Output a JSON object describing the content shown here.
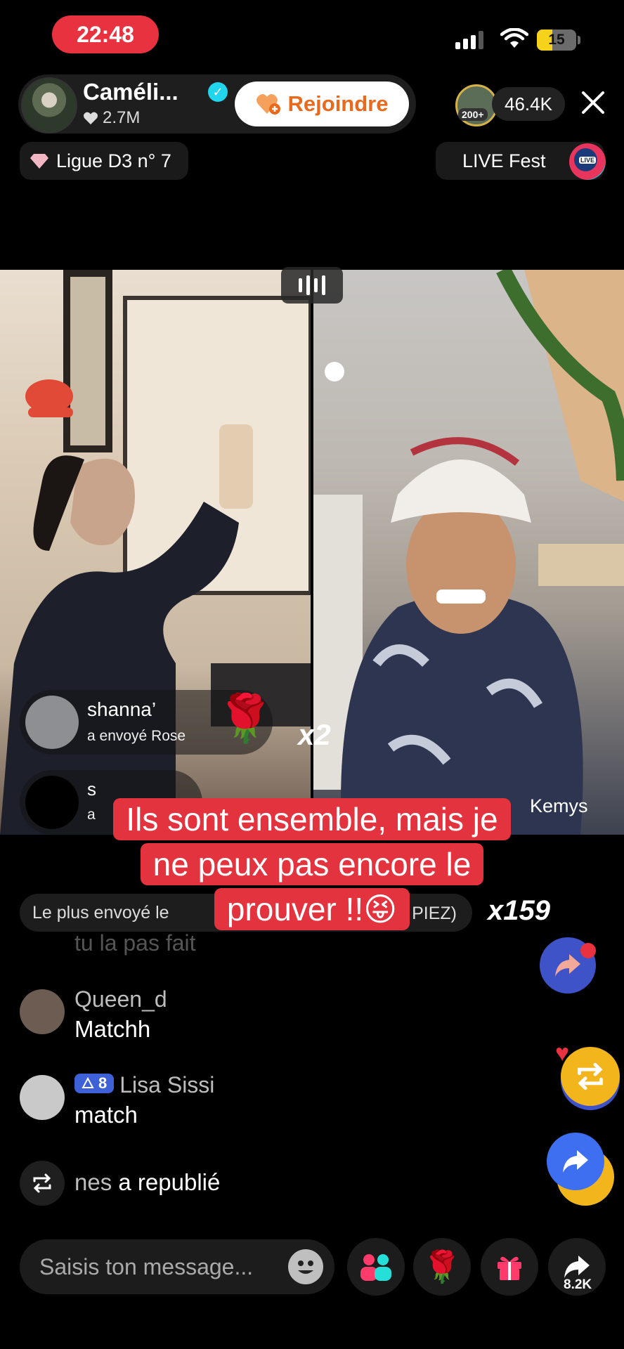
{
  "status_bar": {
    "time": "22:48",
    "battery": "15"
  },
  "host": {
    "name": "Caméli...",
    "likes": "2.7M",
    "join_label": "Rejoindre"
  },
  "viewers": {
    "badge": "200+",
    "count": "46.4K"
  },
  "league": {
    "label": "Ligue D3 n° 7"
  },
  "fest": {
    "label": "LIVE Fest",
    "icon_text": "LIVE"
  },
  "battle": {
    "gifts": [
      {
        "user": "shanna’",
        "action": "a envoyé  Rose",
        "multiplier": "x2"
      },
      {
        "user": "s",
        "action": "a"
      }
    ],
    "opponent_name": "Kemys"
  },
  "caption": {
    "lines": [
      "Ils sont ensemble, mais je",
      "ne peux pas encore le",
      "prouver !!😝"
    ]
  },
  "most_sent": {
    "label": "Le plus envoyé  le",
    "tail": "PIEZ)",
    "count": "x159"
  },
  "chat": {
    "faded": "tu la pas fait",
    "messages": [
      {
        "user": "Queen_d",
        "text": "Matchh"
      },
      {
        "user": "Lisa Sissi",
        "level": "8",
        "text": "match"
      }
    ],
    "repost": {
      "user": "nes",
      "text": "a republié"
    }
  },
  "input": {
    "placeholder": "Saisis ton message..."
  },
  "bottom": {
    "share_count": "8.2K"
  },
  "colors": {
    "accent_red": "#e3333f",
    "join_orange": "#ea6a1d",
    "repost_gold": "#f2b51c",
    "share_blue": "#3e6ff0"
  }
}
